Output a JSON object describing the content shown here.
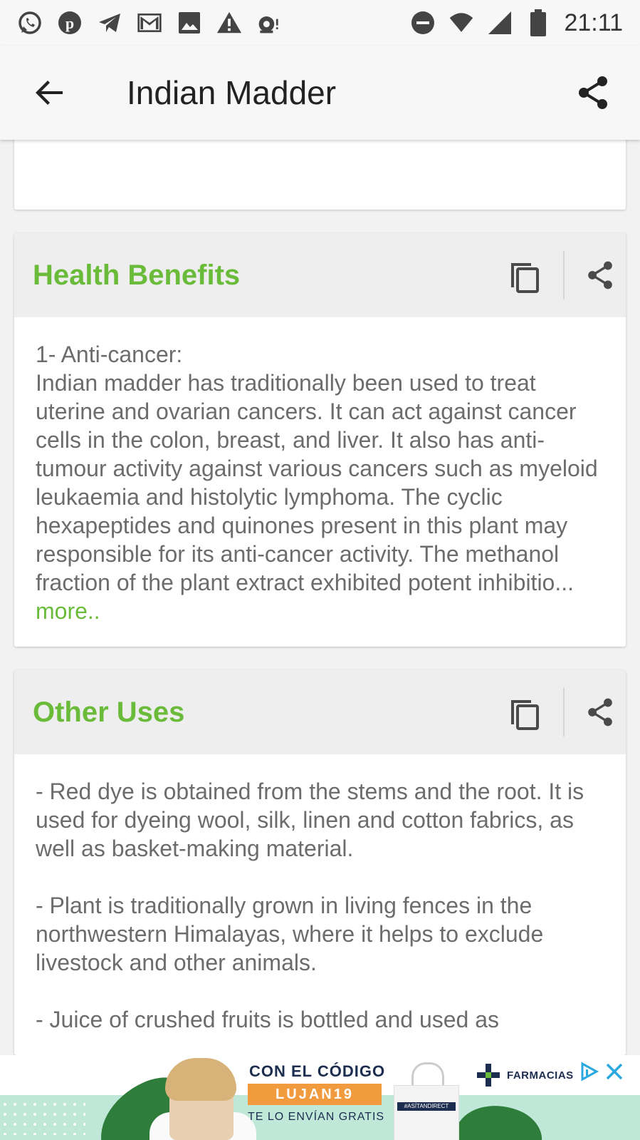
{
  "status_bar": {
    "time": "21:11",
    "left_icons": [
      "whatsapp-icon",
      "pinterest-icon",
      "telegram-icon",
      "gmail-icon",
      "gallery-icon",
      "warning-icon",
      "notification-icon"
    ],
    "right_icons": [
      "do-not-disturb-icon",
      "wifi-icon",
      "signal-icon",
      "battery-icon"
    ]
  },
  "app_bar": {
    "title": "Indian Madder",
    "back_icon": "arrow-back-icon",
    "share_icon": "share-icon"
  },
  "sections": [
    {
      "title": "Health Benefits",
      "body": "1- Anti-cancer:\nIndian madder has traditionally been used to treat uterine and ovarian cancers. It can act against cancer cells in the colon, breast, and liver. It also has anti-tumour activity against various cancers such as myeloid leukaemia and histolytic lymphoma. The cyclic hexapeptides and quinones present in this plant may responsible for its anti-cancer activity. The methanol fraction of the plant extract exhibited potent inhibitio... ",
      "more_label": "more.."
    },
    {
      "title": "Other Uses",
      "paragraphs": [
        "- Red dye is obtained from the stems and the root. It is used for dyeing wool, silk, linen and cotton fabrics, as well as basket-making material.",
        "- Plant is traditionally grown in living fences in the northwestern Himalayas, where it helps to exclude livestock and other animals.",
        "- Juice of crushed fruits is bottled and used as"
      ]
    }
  ],
  "ad": {
    "headline": "CON EL CÓDIGO",
    "code": "LUJAN19",
    "subline": "TE LO ENVÍAN GRATIS",
    "bag_label": "#ASÍTANDIRECT",
    "brand": "FARMACIAS"
  },
  "colors": {
    "accent_green": "#6bbb3b",
    "body_text": "#6c6c6c",
    "header_bg": "#eeeeee"
  }
}
